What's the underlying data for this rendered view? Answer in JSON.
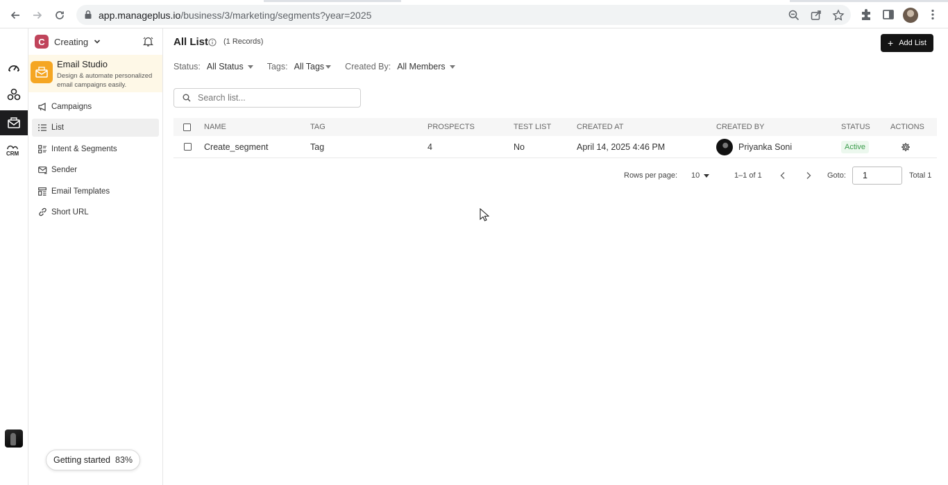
{
  "browser": {
    "url_host": "app.manageplus.io",
    "url_path": "/business/3/marketing/segments?year=2025"
  },
  "rail": {
    "items": [
      "dashboard-icon",
      "network-icon",
      "email-studio-icon",
      "crm-icon"
    ],
    "crm_label": "CRM"
  },
  "workspace": {
    "logo_letter": "C",
    "name": "Creating"
  },
  "studio": {
    "title": "Email Studio",
    "description": "Design & automate personalized email campaigns easily."
  },
  "menu": {
    "items": [
      {
        "label": "Campaigns",
        "icon": "megaphone-icon"
      },
      {
        "label": "List",
        "icon": "list-icon"
      },
      {
        "label": "Intent & Segments",
        "icon": "segments-icon"
      },
      {
        "label": "Sender",
        "icon": "mail-send-icon"
      },
      {
        "label": "Email Templates",
        "icon": "template-icon"
      },
      {
        "label": "Short URL",
        "icon": "link-icon"
      }
    ],
    "active_index": 1
  },
  "getting_started": {
    "label": "Getting started",
    "percent": "83%"
  },
  "main": {
    "title": "All List",
    "records": "(1 Records)",
    "add_button": "Add List",
    "filters": {
      "status_label": "Status:",
      "status_value": "All Status",
      "tags_label": "Tags:",
      "tags_value": "All Tags",
      "created_label": "Created By:",
      "created_value": "All Members"
    },
    "search_placeholder": "Search list..."
  },
  "table": {
    "columns": [
      "NAME",
      "TAG",
      "PROSPECTS",
      "TEST LIST",
      "CREATED AT",
      "CREATED BY",
      "STATUS",
      "ACTIONS"
    ],
    "rows": [
      {
        "name": "Create_segment",
        "tag": "Tag",
        "prospects": "4",
        "test_list": "No",
        "created_at": "April 14, 2025 4:46 PM",
        "created_by": "Priyanka Soni",
        "status": "Active"
      }
    ]
  },
  "pagination": {
    "rows_per_page_label": "Rows per page:",
    "rows_per_page": "10",
    "range": "1–1 of 1",
    "goto_label": "Goto:",
    "goto_value": "1",
    "total": "Total 1"
  },
  "colors": {
    "accent_dark": "#141414",
    "workspace_logo": "#c0445b",
    "studio_icon": "#f5a623",
    "active_badge_text": "#3a9b4b"
  }
}
